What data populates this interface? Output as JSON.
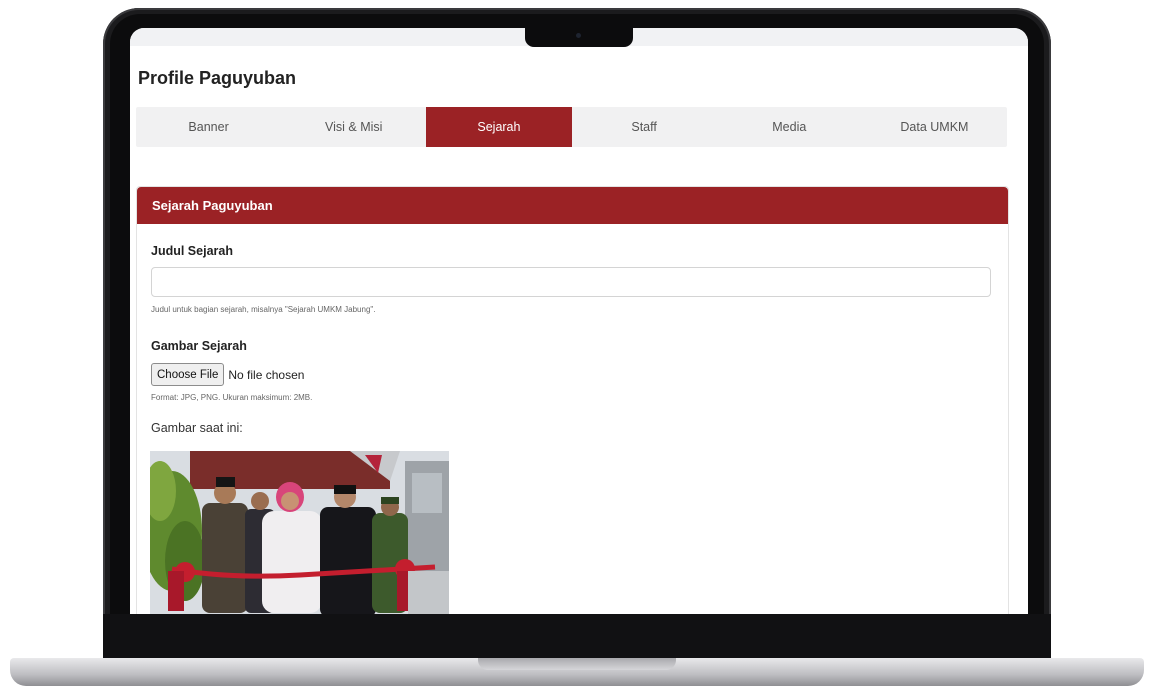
{
  "page": {
    "title": "Profile Paguyuban"
  },
  "tabs": [
    {
      "label": "Banner",
      "active": false
    },
    {
      "label": "Visi & Misi",
      "active": false
    },
    {
      "label": "Sejarah",
      "active": true
    },
    {
      "label": "Staff",
      "active": false
    },
    {
      "label": "Media",
      "active": false
    },
    {
      "label": "Data UMKM",
      "active": false
    }
  ],
  "section": {
    "header": "Sejarah Paguyuban",
    "judul": {
      "label": "Judul Sejarah",
      "value": "",
      "help": "Judul untuk bagian sejarah, misalnya \"Sejarah UMKM Jabung\"."
    },
    "gambar": {
      "label": "Gambar Sejarah",
      "button_label": "Choose File",
      "status": "No file chosen",
      "help": "Format: JPG, PNG. Ukuran maksimum: 2MB.",
      "current_label": "Gambar saat ini:"
    }
  },
  "colors": {
    "accent": "#9b2225",
    "tab_bar": "#f1f1f2"
  }
}
